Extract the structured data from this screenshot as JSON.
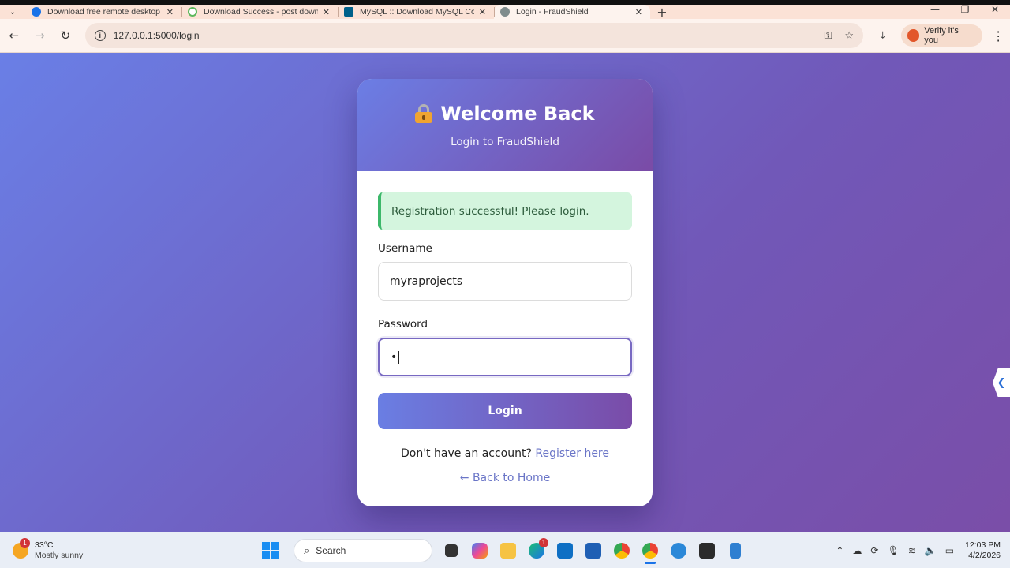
{
  "browser": {
    "tabs": [
      {
        "title": "Download free remote desktop",
        "favicon_color": "#1a73e8",
        "active": false
      },
      {
        "title": "Download Success - post down",
        "favicon_color": "#5cb85c",
        "active": false
      },
      {
        "title": "MySQL :: Download MySQL Co",
        "favicon_color": "#00618a",
        "active": false
      },
      {
        "title": "Login - FraudShield",
        "favicon_color": "#7f8c8d",
        "active": true
      }
    ],
    "url": "127.0.0.1:5000/login",
    "profile_label": "Verify it's you"
  },
  "card": {
    "title": "Welcome Back",
    "subtitle": "Login to FraudShield",
    "alert": "Registration successful! Please login.",
    "username_label": "Username",
    "username_value": "myraprojects",
    "password_label": "Password",
    "password_value": "•",
    "login_label": "Login",
    "register_prompt": "Don't have an account?",
    "register_link": "Register here",
    "back_link": "← Back to Home"
  },
  "taskbar": {
    "weather_temp": "33°C",
    "weather_cond": "Mostly sunny",
    "weather_badge": "1",
    "search_label": "Search",
    "time": "12:03 PM",
    "date": "4/2/2026"
  },
  "colors": {
    "accent_start": "#6a7ee3",
    "accent_end": "#7a4ca8",
    "success_bg": "#d4f5de",
    "success_border": "#3cb86a"
  }
}
